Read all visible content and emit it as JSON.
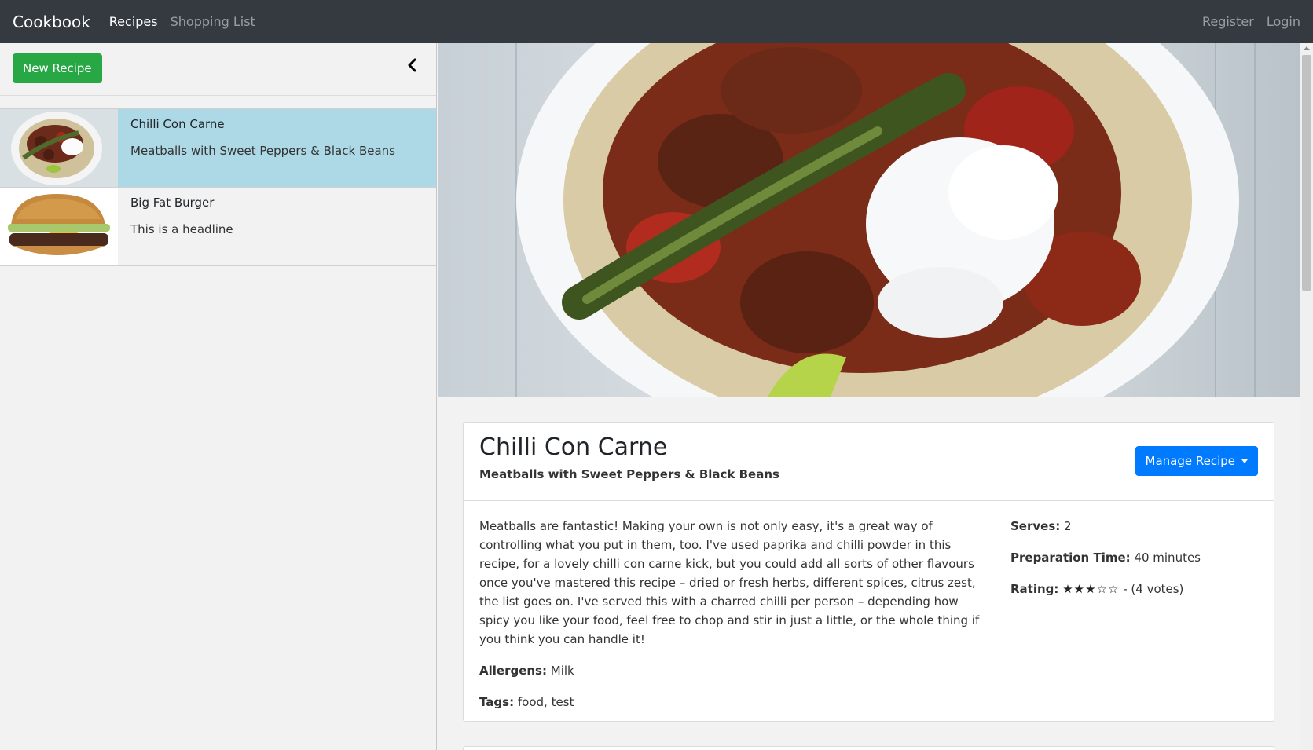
{
  "navbar": {
    "brand": "Cookbook",
    "links": [
      "Recipes",
      "Shopping List"
    ],
    "right_links": [
      "Register",
      "Login"
    ]
  },
  "sidebar": {
    "new_button": "New Recipe",
    "items": [
      {
        "title": "Chilli Con Carne",
        "subtitle": "Meatballs with Sweet Peppers & Black Beans",
        "selected": true
      },
      {
        "title": "Big Fat Burger",
        "subtitle": "This is a headline",
        "selected": false
      }
    ]
  },
  "recipe": {
    "title": "Chilli Con Carne",
    "subtitle": "Meatballs with Sweet Peppers & Black Beans",
    "manage_button": "Manage Recipe",
    "description": "Meatballs are fantastic! Making your own is not only easy, it's a great way of controlling what you put in them, too. I've used paprika and chilli powder in this recipe, for a lovely chilli con carne kick, but you could add all sorts of other flavours once you've mastered this recipe – dried or fresh herbs, different spices, citrus zest, the list goes on. I've served this with a charred chilli per person – depending how spicy you like your food, feel free to chop and stir in just a little, or the whole thing if you think you can handle it!",
    "allergens_label": "Allergens:",
    "allergens": "Milk",
    "tags_label": "Tags:",
    "tags": "food, test",
    "serves_label": "Serves:",
    "serves": "2",
    "prep_label": "Preparation Time:",
    "prep": "40 minutes",
    "rating_label": "Rating:",
    "rating_stars": "★★★☆☆",
    "rating_value": 3,
    "rating_votes": "- (4 votes)"
  },
  "colors": {
    "navbar": "#343a40",
    "selected_row": "#add8e6",
    "new_button": "#28a745",
    "manage_button": "#007bff"
  }
}
